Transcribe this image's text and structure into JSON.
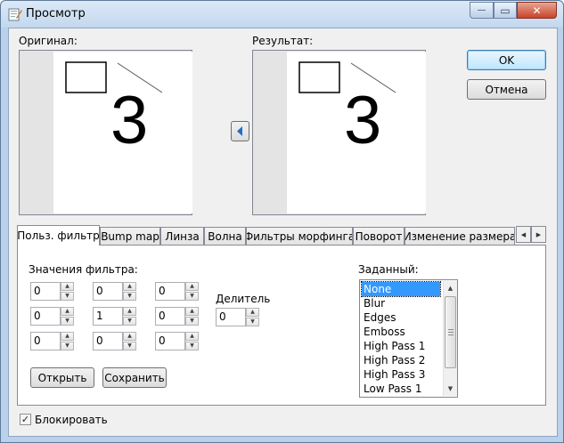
{
  "window": {
    "title": "Просмотр",
    "min_glyph": "—",
    "max_glyph": "▭",
    "close_glyph": "✕"
  },
  "original": {
    "label": "Оригинал:",
    "digit": "3"
  },
  "result": {
    "label": "Результат:",
    "digit": "3"
  },
  "copy_button_icon": "arrow-left-icon",
  "buttons": {
    "ok": "OK",
    "cancel": "Отмена",
    "open": "Открыть",
    "save": "Сохранить"
  },
  "tabs": [
    {
      "label": "Польз. фильтр",
      "active": true
    },
    {
      "label": "Bump map"
    },
    {
      "label": "Линза"
    },
    {
      "label": "Волна"
    },
    {
      "label": "Фильтры морфинга"
    },
    {
      "label": "Поворот"
    },
    {
      "label": "Изменение размера"
    }
  ],
  "tab_scroll": {
    "left": "◀",
    "right": "▶"
  },
  "filter": {
    "values_label": "Значения фильтра:",
    "matrix": [
      "0",
      "0",
      "0",
      "0",
      "1",
      "0",
      "0",
      "0",
      "0"
    ],
    "divisor_label": "Делитель",
    "divisor": "0",
    "spin_up": "▲",
    "spin_down": "▼"
  },
  "preset": {
    "label": "Заданный:",
    "items": [
      "None",
      "Blur",
      "Edges",
      "Emboss",
      "High Pass 1",
      "High Pass 2",
      "High Pass 3",
      "Low Pass 1"
    ],
    "selected": "None",
    "scroll_up": "▲",
    "scroll_down": "▼"
  },
  "lock": {
    "label": "Блокировать",
    "checked": true,
    "check_glyph": "✓"
  },
  "colors": {
    "selection": "#3399ff",
    "titlebar": "#c3d8ee",
    "close_button": "#c7452a",
    "arrow_icon": "#1f6fc5"
  }
}
